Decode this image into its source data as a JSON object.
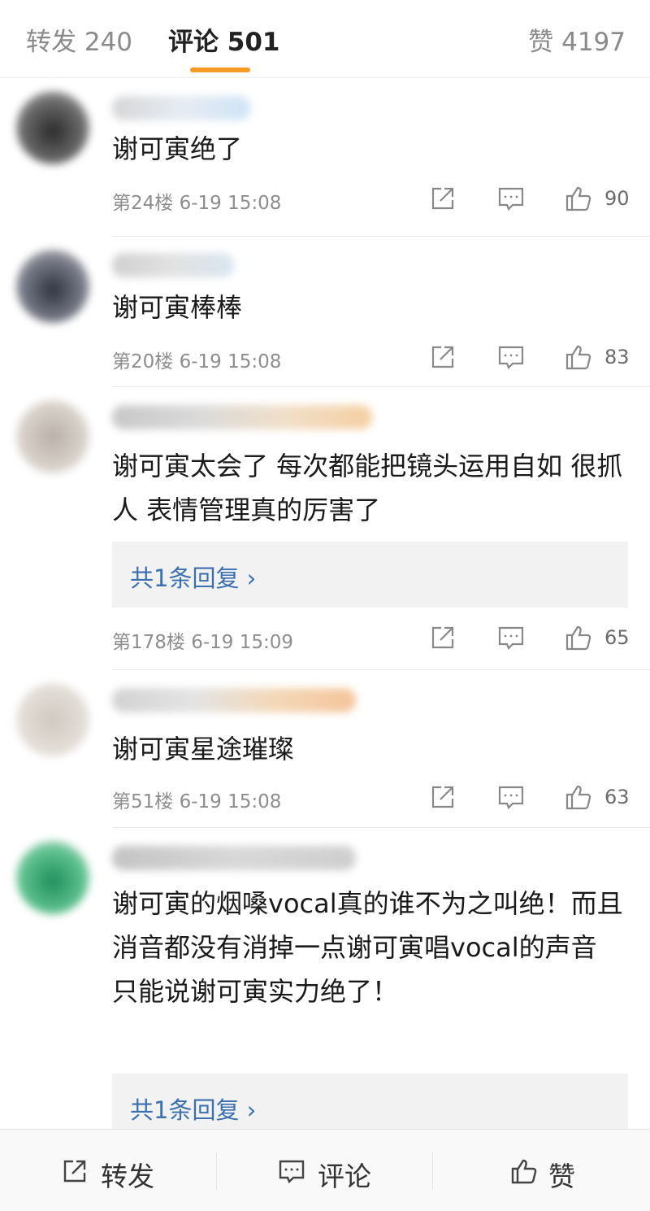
{
  "tabs": {
    "repost": "转发 240",
    "comment": "评论 501",
    "like": "赞 4197",
    "accent": "#f59a23"
  },
  "comments": [
    {
      "text": "谢可寅绝了",
      "floor": "第24楼",
      "time": "6-19 15:08",
      "likes": "90",
      "avatar_color": "#3e3e3e"
    },
    {
      "text": "谢可寅棒棒",
      "floor": "第20楼",
      "time": "6-19 15:08",
      "likes": "83",
      "avatar_color": "#4a4a52"
    },
    {
      "text": "谢可寅太会了 每次都能把镜头运用自如 很抓人 表情管理真的厉害了",
      "floor": "第178楼",
      "time": "6-19 15:09",
      "likes": "65",
      "reply": "共1条回复 ›",
      "avatar_color": "#cfc7c0"
    },
    {
      "text": "谢可寅星途璀璨",
      "floor": "第51楼",
      "time": "6-19 15:08",
      "likes": "63",
      "avatar_color": "#d9d4cc"
    },
    {
      "text": "谢可寅的烟嗓vocal真的谁不为之叫绝！而且消音都没有消掉一点谢可寅唱vocal的声音 只能说谢可寅实力绝了！",
      "reply": "共1条回复 ›",
      "avatar_color": "#2f9f6a"
    }
  ],
  "bottom": {
    "repost": "转发",
    "comment": "评论",
    "like": "赞"
  },
  "icons": [
    "share-icon",
    "comment-icon",
    "thumb-up-icon",
    "chevron-right-icon"
  ]
}
